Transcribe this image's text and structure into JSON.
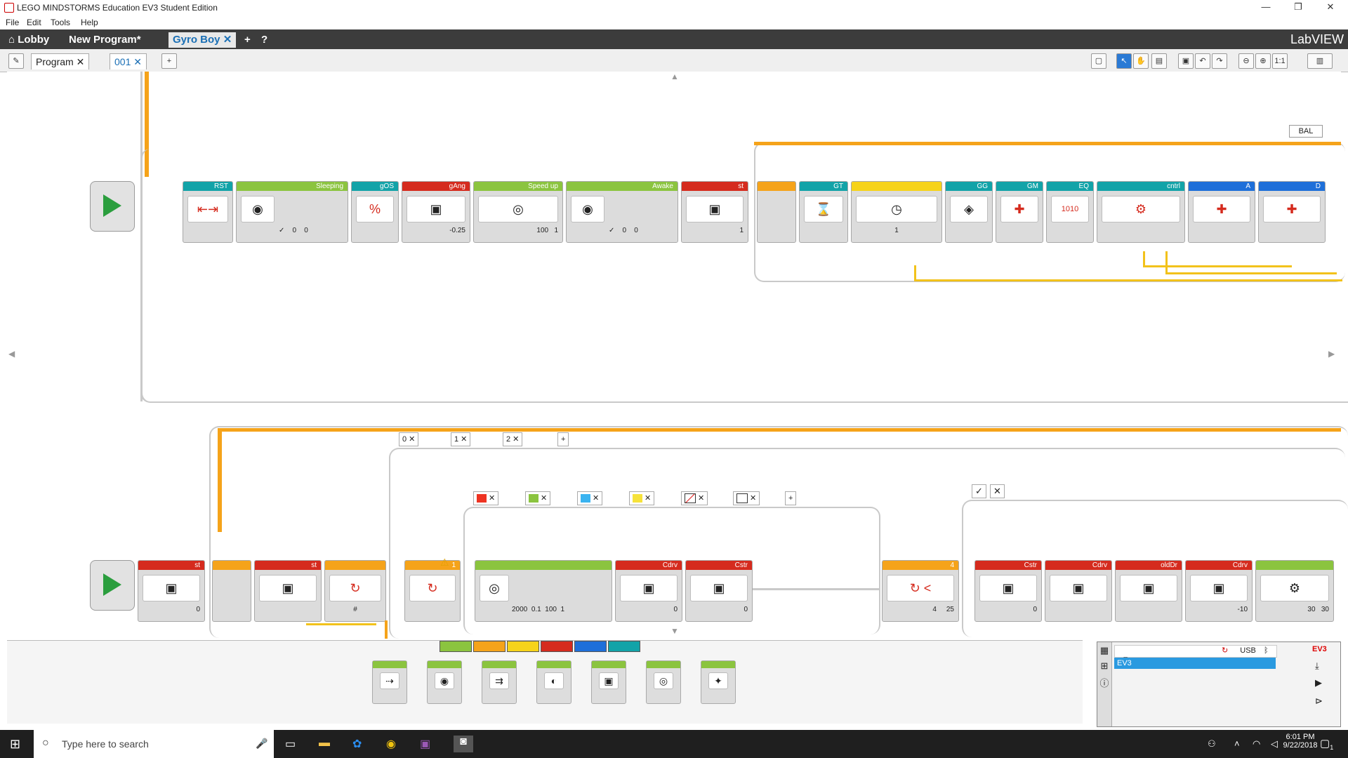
{
  "window": {
    "title": "LEGO MINDSTORMS Education EV3 Student Edition"
  },
  "menu": [
    "File",
    "Edit",
    "Tools",
    "Help"
  ],
  "project_tabs": [
    {
      "label": "Lobby"
    },
    {
      "label": "New Program*"
    },
    {
      "label": "Gyro Boy",
      "active": true
    }
  ],
  "brand": "LabVIEW",
  "program_tabs": [
    {
      "label": "Program"
    },
    {
      "label": "001",
      "active": true
    }
  ],
  "top_row": {
    "blocks": [
      {
        "name": "RST",
        "color": "teal",
        "icon": "⇤⇥"
      },
      {
        "name": "Sleeping",
        "color": "green",
        "icon": "◉",
        "params": [
          "✓",
          "0",
          "0"
        ]
      },
      {
        "name": "gOS",
        "color": "teal",
        "icon": "%"
      },
      {
        "name": "gAng",
        "color": "red",
        "icon": "▣",
        "params": [
          "-0.25"
        ]
      },
      {
        "name": "Speed up",
        "color": "green",
        "icon": "◎",
        "params": [
          "100",
          "1"
        ]
      },
      {
        "name": "Awake",
        "color": "green",
        "icon": "◉",
        "params": [
          "✓",
          "0",
          "0"
        ]
      },
      {
        "name": "st",
        "color": "red",
        "icon": "▣",
        "params": [
          "1"
        ]
      }
    ],
    "loop_label": "BAL",
    "loop_blocks": [
      {
        "name": "GT",
        "color": "teal",
        "icon": "⌛"
      },
      {
        "name": "",
        "color": "yellow",
        "icon": "◷",
        "params": [
          "1"
        ]
      },
      {
        "name": "GG",
        "color": "teal",
        "icon": "◈"
      },
      {
        "name": "GM",
        "color": "teal",
        "icon": "✚"
      },
      {
        "name": "EQ",
        "color": "teal",
        "icon": "1010"
      },
      {
        "name": "cntrl",
        "color": "teal",
        "icon": "⚙"
      },
      {
        "name": "A",
        "color": "blue",
        "icon": "✚"
      },
      {
        "name": "D",
        "color": "blue",
        "icon": "✚"
      }
    ]
  },
  "bottom_row": {
    "blocks": [
      {
        "name": "st",
        "color": "red",
        "icon": "▣",
        "params": [
          "0"
        ]
      },
      {
        "name": "st",
        "color": "red",
        "icon": "▣"
      },
      {
        "name": "",
        "color": "orange",
        "icon": "↻",
        "params": [
          "#"
        ]
      },
      {
        "name": "1",
        "color": "orange",
        "icon": "↻"
      }
    ],
    "case_tabs": [
      "0",
      "1",
      "2"
    ],
    "color_case_blocks": [
      {
        "name": "",
        "color": "green",
        "icon": "◎",
        "params": [
          "2000",
          "0.1",
          "100",
          "1"
        ]
      },
      {
        "name": "Cdrv",
        "color": "red",
        "icon": "▣",
        "params": [
          "0"
        ]
      },
      {
        "name": "Cstr",
        "color": "red",
        "icon": "▣",
        "params": [
          "0"
        ]
      }
    ],
    "compare_block": {
      "name": "4",
      "color": "orange",
      "params": [
        "4",
        "25"
      ]
    },
    "right_blocks": [
      {
        "name": "Cstr",
        "color": "red",
        "icon": "▣",
        "params": [
          "0"
        ]
      },
      {
        "name": "Cdrv",
        "color": "red",
        "icon": "▣"
      },
      {
        "name": "oldDr",
        "color": "red",
        "icon": "▣"
      },
      {
        "name": "Cdrv",
        "color": "red",
        "icon": "▣",
        "params": [
          "-10"
        ]
      },
      {
        "name": "",
        "color": "green",
        "icon": "⚙",
        "params": [
          "30",
          "30"
        ]
      }
    ]
  },
  "palette": {
    "tab_colors": [
      "#8bc43f",
      "#f5a31a",
      "#f6d31a",
      "#d52b1e",
      "#1e6fd9",
      "#12a3a8"
    ],
    "blocks": [
      "move-steering",
      "large-motor",
      "move-tank",
      "medium-motor",
      "display",
      "sound",
      "brick-status-light"
    ]
  },
  "hardware": {
    "tabs": [
      "USB"
    ],
    "brick_label": "EV3",
    "device": "EV3"
  },
  "taskbar": {
    "search_placeholder": "Type here to search",
    "time": "6:01 PM",
    "date": "9/22/2018",
    "notification_count": "1"
  }
}
